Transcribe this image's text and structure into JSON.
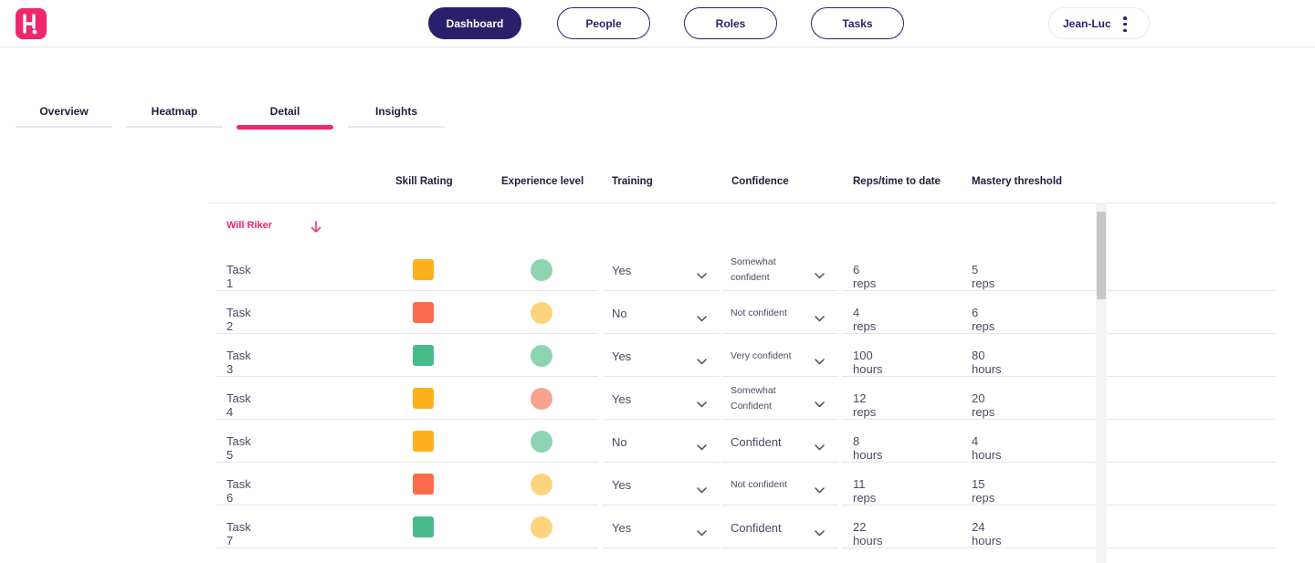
{
  "nav": {
    "buttons": [
      "Dashboard",
      "People",
      "Roles",
      "Tasks"
    ],
    "active": "Dashboard",
    "user": "Jean-Luc"
  },
  "tabs": [
    "Overview",
    "Heatmap",
    "Detail",
    "Insights"
  ],
  "active_tab": "Detail",
  "table": {
    "headers": [
      "Skill Rating",
      "Experience level",
      "Training",
      "Confidence",
      "Reps/time to date",
      "Mastery threshold"
    ],
    "group": "Will Riker",
    "rows": [
      {
        "task": "Task 1",
        "skill": "amber",
        "experience": "green",
        "training": "Yes",
        "confidence": "Somewhat confident",
        "to_date": "6 reps",
        "threshold": "5 reps"
      },
      {
        "task": "Task 2",
        "skill": "red",
        "experience": "yellow",
        "training": "No",
        "confidence": "Not confident",
        "to_date": "4 reps",
        "threshold": "6 reps"
      },
      {
        "task": "Task 3",
        "skill": "green",
        "experience": "green",
        "training": "Yes",
        "confidence": "Very confident",
        "to_date": "100 hours",
        "threshold": "80 hours"
      },
      {
        "task": "Task 4",
        "skill": "amber",
        "experience": "salmon",
        "training": "Yes",
        "confidence": "Somewhat Confident",
        "to_date": "12 reps",
        "threshold": "20 reps"
      },
      {
        "task": "Task 5",
        "skill": "amber",
        "experience": "green",
        "training": "No",
        "confidence": "Confident",
        "to_date": "8 hours",
        "threshold": "4 hours"
      },
      {
        "task": "Task 6",
        "skill": "red",
        "experience": "yellow",
        "training": "Yes",
        "confidence": "Not confident",
        "to_date": "11 reps",
        "threshold": "15 reps"
      },
      {
        "task": "Task 7",
        "skill": "green",
        "experience": "yellow",
        "training": "Yes",
        "confidence": "Confident",
        "to_date": "22 hours",
        "threshold": "24 hours"
      }
    ]
  },
  "colors": {
    "accent": "#f0266f",
    "navy": "#2a1f6b",
    "amber": "#fdb11c",
    "red": "#fc6b4b",
    "green": "#48bb89",
    "light_green": "#8ed4b1",
    "yellow": "#fdd47c",
    "salmon": "#f8a290"
  },
  "icons": {
    "logo": "brand-logo-icon",
    "menu": "more-vertical-icon",
    "sort": "arrow-down-icon",
    "dropdown": "chevron-down-icon"
  }
}
